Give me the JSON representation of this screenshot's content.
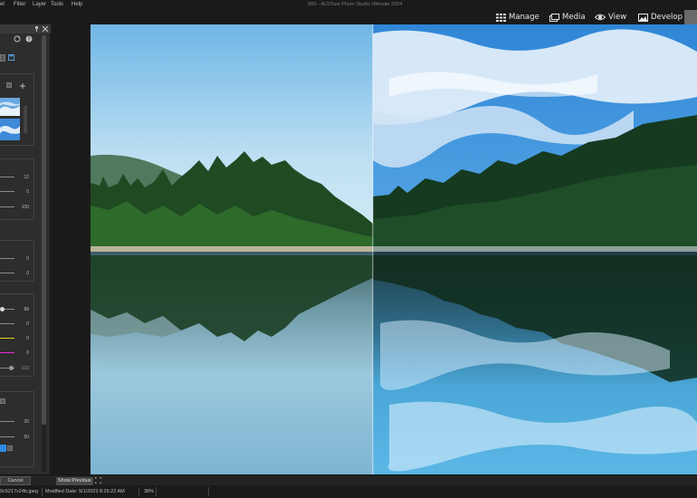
{
  "menu": {
    "items": [
      "et",
      "Filter",
      "Layer",
      "Tools",
      "Help"
    ],
    "app_title": "58S - ACDSee Photo Studio Ultimate 2024"
  },
  "modes": {
    "manage": "Manage",
    "media": "Media",
    "view": "View",
    "develop": "Develop"
  },
  "panel": {
    "values": {
      "v1": "12",
      "v2": "0",
      "v3": "100",
      "v4": "0",
      "v5": "0",
      "v6": "88",
      "v7": "0",
      "v8": "0",
      "v9": "0",
      "v10": "100",
      "v11": "20",
      "v12": "50"
    },
    "colors": {
      "accent_yellow": "#e8d21a",
      "accent_magenta": "#e22ad2",
      "accent_blue": "#2b8de0"
    }
  },
  "actions": {
    "cancel": "Cancel",
    "show_previous": "Show Previous"
  },
  "status": {
    "filename": "0c5217x24b.jpeg",
    "modified": "Modified Date: 9/1/2023 8:26:22 AM",
    "zoom": "38%"
  }
}
